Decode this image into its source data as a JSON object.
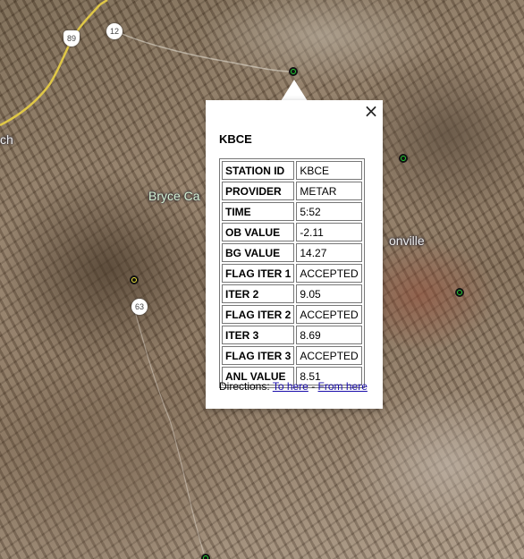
{
  "map": {
    "place_labels": [
      "Bryce Ca",
      "onville",
      "ch"
    ],
    "route_shields": [
      "89",
      "12",
      "63"
    ],
    "markers": [
      {
        "color": "green"
      },
      {
        "color": "green"
      },
      {
        "color": "green"
      },
      {
        "color": "yellow"
      },
      {
        "color": "green"
      }
    ]
  },
  "popup": {
    "close_icon": "×",
    "title": "KBCE",
    "rows": [
      {
        "label": "STATION ID",
        "value": "KBCE"
      },
      {
        "label": "PROVIDER",
        "value": "METAR"
      },
      {
        "label": "TIME",
        "value": "5:52"
      },
      {
        "label": "OB VALUE",
        "value": "-2.11"
      },
      {
        "label": "BG VALUE",
        "value": "14.27"
      },
      {
        "label": "FLAG ITER 1",
        "value": "ACCEPTED"
      },
      {
        "label": "ITER 2",
        "value": "9.05"
      },
      {
        "label": "FLAG ITER 2",
        "value": "ACCEPTED"
      },
      {
        "label": "ITER 3",
        "value": "8.69"
      },
      {
        "label": "FLAG ITER 3",
        "value": "ACCEPTED"
      },
      {
        "label": "ANL VALUE",
        "value": "8.51"
      }
    ],
    "directions_label": "Directions:",
    "to_here": "To here",
    "separator": "-",
    "from_here": "From here"
  }
}
